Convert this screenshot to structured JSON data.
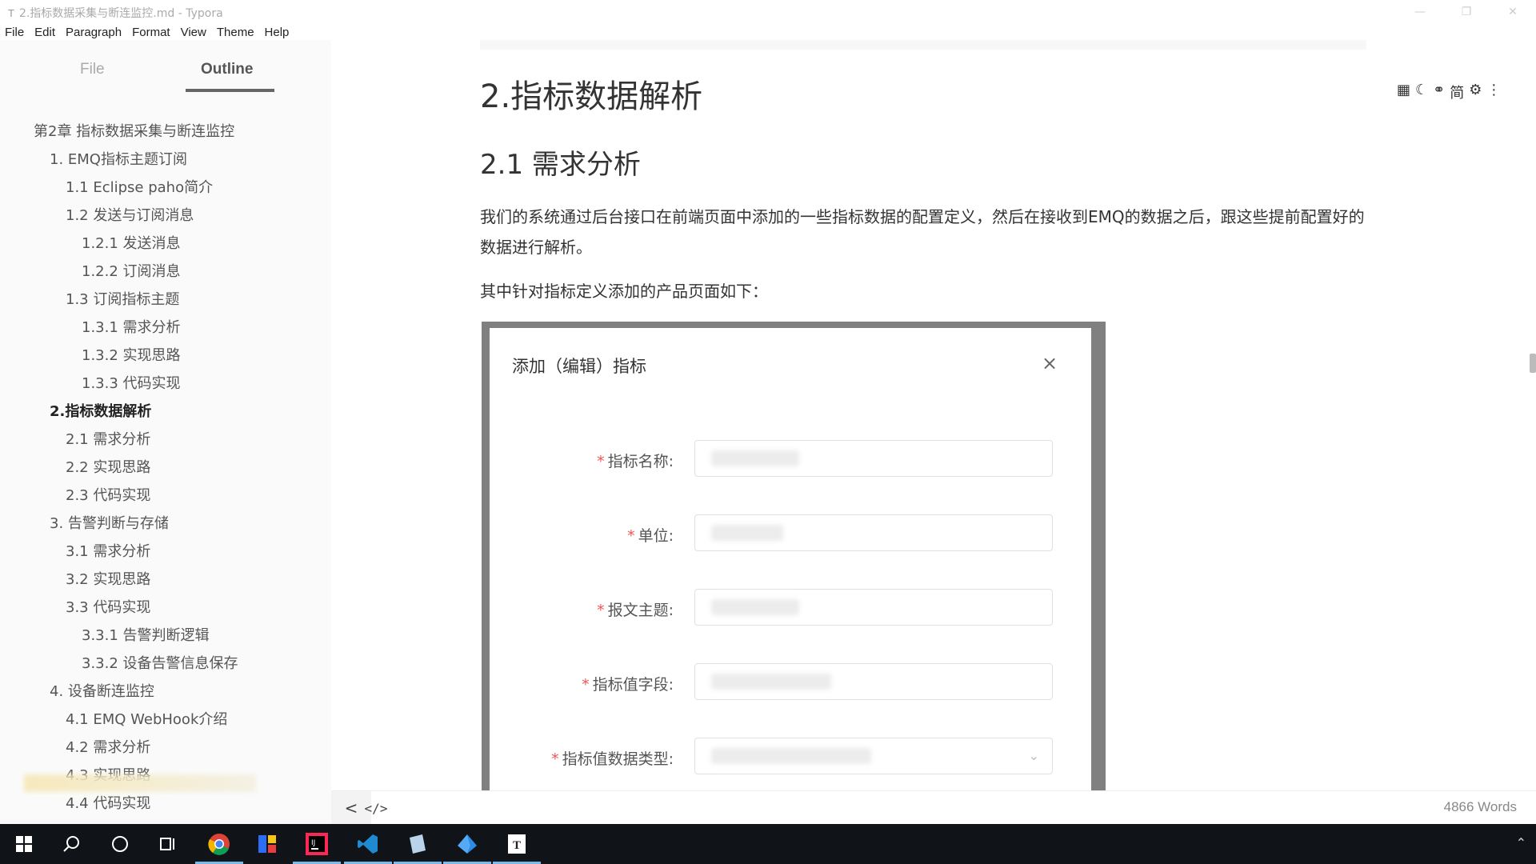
{
  "window": {
    "title": "2.指标数据采集与断连监控.md - Typora",
    "app_icon": "T",
    "controls": [
      "minimize-icon",
      "restore-icon",
      "close-icon"
    ]
  },
  "menu": [
    "File",
    "Edit",
    "Paragraph",
    "Format",
    "View",
    "Theme",
    "Help"
  ],
  "sidebar": {
    "tabs": {
      "file": "File",
      "outline": "Outline"
    },
    "active_tab": "Outline",
    "outline": [
      {
        "label": "第2章 指标数据采集与断连监控",
        "level": 0
      },
      {
        "label": "1. EMQ指标主题订阅",
        "level": 1
      },
      {
        "label": "1.1 Eclipse paho简介",
        "level": 2
      },
      {
        "label": "1.2 发送与订阅消息",
        "level": 2
      },
      {
        "label": "1.2.1 发送消息",
        "level": 3
      },
      {
        "label": "1.2.2 订阅消息",
        "level": 3
      },
      {
        "label": "1.3 订阅指标主题",
        "level": 2
      },
      {
        "label": "1.3.1 需求分析",
        "level": 3
      },
      {
        "label": "1.3.2 实现思路",
        "level": 3
      },
      {
        "label": "1.3.3 代码实现",
        "level": 3
      },
      {
        "label": "2.指标数据解析",
        "level": 1,
        "active": true
      },
      {
        "label": "2.1 需求分析",
        "level": 2
      },
      {
        "label": "2.2 实现思路",
        "level": 2
      },
      {
        "label": "2.3 代码实现",
        "level": 2
      },
      {
        "label": "3. 告警判断与存储",
        "level": 1
      },
      {
        "label": "3.1 需求分析",
        "level": 2
      },
      {
        "label": "3.2 实现思路",
        "level": 2
      },
      {
        "label": "3.3 代码实现",
        "level": 2
      },
      {
        "label": "3.3.1 告警判断逻辑",
        "level": 3
      },
      {
        "label": "3.3.2 设备告警信息保存",
        "level": 3
      },
      {
        "label": "4. 设备断连监控",
        "level": 1
      },
      {
        "label": "4.1 EMQ WebHook介绍",
        "level": 2
      },
      {
        "label": "4.2 需求分析",
        "level": 2
      },
      {
        "label": "4.3 实现思路",
        "level": 2
      },
      {
        "label": "4.4 代码实现",
        "level": 2
      }
    ]
  },
  "content": {
    "h2": "2.指标数据解析",
    "h3": "2.1 需求分析",
    "paragraph1": "我们的系统通过后台接口在前端页面中添加的一些指标数据的配置定义，然后在接收到EMQ的数据之后，跟这些提前配置好的数据进行解析。",
    "paragraph2": "其中针对指标定义添加的产品页面如下：",
    "side_tools": [
      "grid-icon",
      "moon-icon",
      "mic-icon",
      "简",
      "gear-icon",
      "more-icon"
    ],
    "image": {
      "dialog_title": "添加（编辑）指标",
      "close_glyph": "×",
      "fields": [
        {
          "label": "指标名称:",
          "required": true,
          "type": "input"
        },
        {
          "label": "单位:",
          "required": true,
          "type": "input"
        },
        {
          "label": "报文主题:",
          "required": true,
          "type": "input"
        },
        {
          "label": "指标值字段:",
          "required": true,
          "type": "input"
        },
        {
          "label": "指标值数据类型:",
          "required": true,
          "type": "select"
        }
      ]
    }
  },
  "statusbar": {
    "back_glyph": "<",
    "source_glyph": "</>",
    "word_count": "4866 Words"
  },
  "taskbar": {
    "items": [
      "start-icon",
      "search-icon",
      "cortana-icon",
      "task-view-icon",
      "chrome-icon",
      "app-icon",
      "intellij-icon",
      "vscode-icon",
      "app2-icon",
      "app3-icon",
      "typora-icon"
    ],
    "running": [
      "chrome-icon",
      "intellij-icon",
      "vscode-icon",
      "app2-icon",
      "app3-icon",
      "typora-icon"
    ],
    "colors": {
      "accent": "#76b9ed",
      "bg": "#101418"
    }
  }
}
